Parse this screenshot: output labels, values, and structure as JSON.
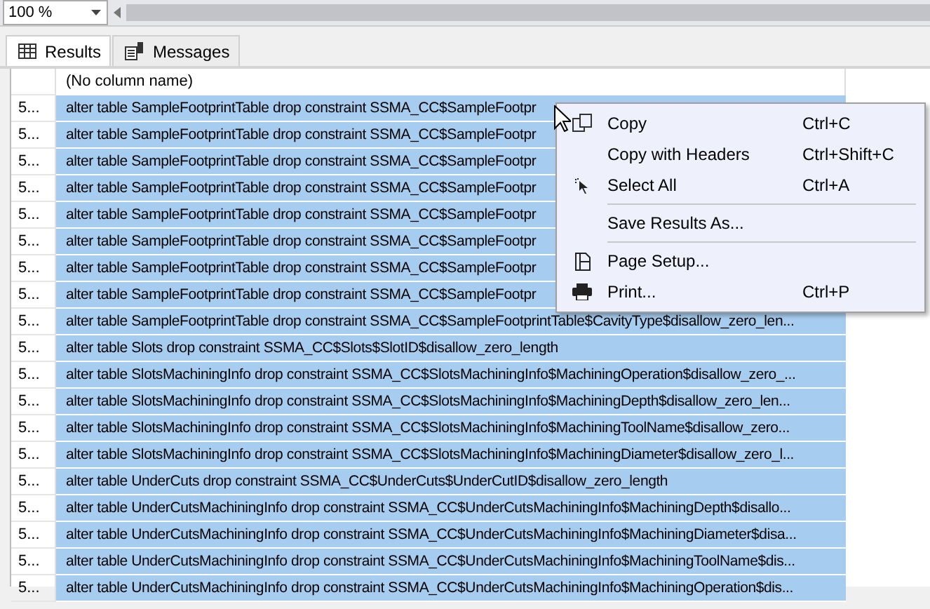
{
  "zoom": {
    "value": "100 %"
  },
  "tabs": [
    {
      "label": "Results",
      "selected": true
    },
    {
      "label": "Messages",
      "selected": false
    }
  ],
  "grid": {
    "columns": [
      "(No column name)"
    ],
    "rows": [
      {
        "num": "5...",
        "text": "alter table SampleFootprintTable drop constraint SSMA_CC$SampleFootpr",
        "selected": true
      },
      {
        "num": "5...",
        "text": "alter table SampleFootprintTable drop constraint SSMA_CC$SampleFootpr",
        "selected": true
      },
      {
        "num": "5...",
        "text": "alter table SampleFootprintTable drop constraint SSMA_CC$SampleFootpr",
        "selected": true
      },
      {
        "num": "5...",
        "text": "alter table SampleFootprintTable drop constraint SSMA_CC$SampleFootpr",
        "selected": true
      },
      {
        "num": "5...",
        "text": "alter table SampleFootprintTable drop constraint SSMA_CC$SampleFootpr",
        "selected": true
      },
      {
        "num": "5...",
        "text": "alter table SampleFootprintTable drop constraint SSMA_CC$SampleFootpr",
        "selected": true
      },
      {
        "num": "5...",
        "text": "alter table SampleFootprintTable drop constraint SSMA_CC$SampleFootpr",
        "selected": true
      },
      {
        "num": "5...",
        "text": "alter table SampleFootprintTable drop constraint SSMA_CC$SampleFootpr",
        "selected": true
      },
      {
        "num": "5...",
        "text": "alter table SampleFootprintTable drop constraint SSMA_CC$SampleFootprintTable$CavityType$disallow_zero_len...",
        "selected": true
      },
      {
        "num": "5...",
        "text": "alter table Slots drop constraint SSMA_CC$Slots$SlotID$disallow_zero_length",
        "selected": true
      },
      {
        "num": "5...",
        "text": "alter table SlotsMachiningInfo drop constraint SSMA_CC$SlotsMachiningInfo$MachiningOperation$disallow_zero_...",
        "selected": true
      },
      {
        "num": "5...",
        "text": "alter table SlotsMachiningInfo drop constraint SSMA_CC$SlotsMachiningInfo$MachiningDepth$disallow_zero_len...",
        "selected": true
      },
      {
        "num": "5...",
        "text": "alter table SlotsMachiningInfo drop constraint SSMA_CC$SlotsMachiningInfo$MachiningToolName$disallow_zero...",
        "selected": true
      },
      {
        "num": "5...",
        "text": "alter table SlotsMachiningInfo drop constraint SSMA_CC$SlotsMachiningInfo$MachiningDiameter$disallow_zero_l...",
        "selected": true
      },
      {
        "num": "5...",
        "text": "alter table UnderCuts drop constraint SSMA_CC$UnderCuts$UnderCutID$disallow_zero_length",
        "selected": true
      },
      {
        "num": "5...",
        "text": "alter table UnderCutsMachiningInfo drop constraint SSMA_CC$UnderCutsMachiningInfo$MachiningDepth$disallo...",
        "selected": true
      },
      {
        "num": "5...",
        "text": "alter table UnderCutsMachiningInfo drop constraint SSMA_CC$UnderCutsMachiningInfo$MachiningDiameter$disa...",
        "selected": true
      },
      {
        "num": "5...",
        "text": "alter table UnderCutsMachiningInfo drop constraint SSMA_CC$UnderCutsMachiningInfo$MachiningToolName$dis...",
        "selected": true
      },
      {
        "num": "5...",
        "text": "alter table UnderCutsMachiningInfo drop constraint SSMA_CC$UnderCutsMachiningInfo$MachiningOperation$dis...",
        "selected": true
      }
    ]
  },
  "context_menu": {
    "items": [
      {
        "kind": "item",
        "label": "Copy",
        "shortcut": "Ctrl+C"
      },
      {
        "kind": "item",
        "label": "Copy with Headers",
        "shortcut": "Ctrl+Shift+C"
      },
      {
        "kind": "item",
        "label": "Select All",
        "shortcut": "Ctrl+A"
      },
      {
        "kind": "separator"
      },
      {
        "kind": "item",
        "label": "Save Results As..."
      },
      {
        "kind": "separator"
      },
      {
        "kind": "item",
        "label": "Page Setup..."
      },
      {
        "kind": "item",
        "label": "Print...",
        "shortcut": "Ctrl+P"
      }
    ]
  }
}
